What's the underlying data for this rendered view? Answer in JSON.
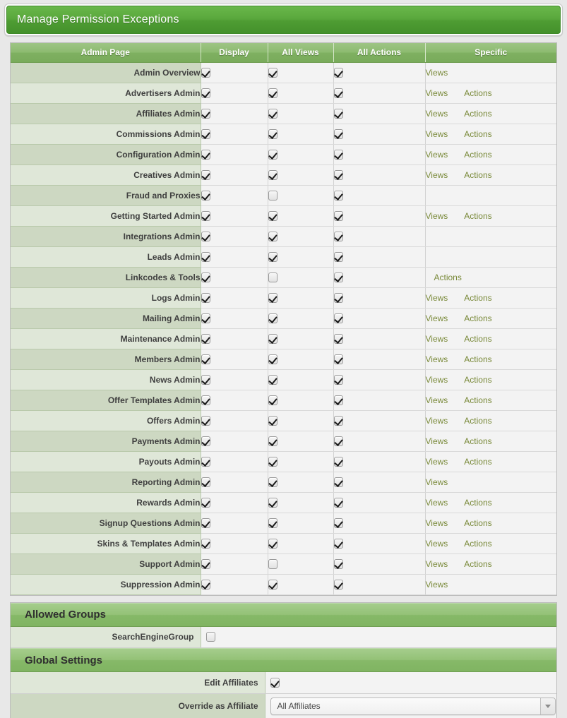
{
  "header": {
    "title": "Manage Permission Exceptions"
  },
  "permissions_table": {
    "columns": [
      "Admin Page",
      "Display",
      "All Views",
      "All Actions",
      "Specific"
    ],
    "specific_labels": {
      "views": "Views",
      "actions": "Actions"
    },
    "rows": [
      {
        "page": "Admin Overview",
        "display": true,
        "all_views": true,
        "all_actions": true,
        "views": true,
        "actions": false
      },
      {
        "page": "Advertisers Admin",
        "display": true,
        "all_views": true,
        "all_actions": true,
        "views": true,
        "actions": true
      },
      {
        "page": "Affiliates Admin",
        "display": true,
        "all_views": true,
        "all_actions": true,
        "views": true,
        "actions": true
      },
      {
        "page": "Commissions Admin",
        "display": true,
        "all_views": true,
        "all_actions": true,
        "views": true,
        "actions": true
      },
      {
        "page": "Configuration Admin",
        "display": true,
        "all_views": true,
        "all_actions": true,
        "views": true,
        "actions": true
      },
      {
        "page": "Creatives Admin",
        "display": true,
        "all_views": true,
        "all_actions": true,
        "views": true,
        "actions": true
      },
      {
        "page": "Fraud and Proxies",
        "display": true,
        "all_views": false,
        "all_actions": true,
        "views": false,
        "actions": false
      },
      {
        "page": "Getting Started Admin",
        "display": true,
        "all_views": true,
        "all_actions": true,
        "views": true,
        "actions": true
      },
      {
        "page": "Integrations Admin",
        "display": true,
        "all_views": true,
        "all_actions": true,
        "views": false,
        "actions": false
      },
      {
        "page": "Leads Admin",
        "display": true,
        "all_views": true,
        "all_actions": true,
        "views": false,
        "actions": false
      },
      {
        "page": "Linkcodes & Tools",
        "display": true,
        "all_views": false,
        "all_actions": true,
        "views": false,
        "actions": true
      },
      {
        "page": "Logs Admin",
        "display": true,
        "all_views": true,
        "all_actions": true,
        "views": true,
        "actions": true
      },
      {
        "page": "Mailing Admin",
        "display": true,
        "all_views": true,
        "all_actions": true,
        "views": true,
        "actions": true
      },
      {
        "page": "Maintenance Admin",
        "display": true,
        "all_views": true,
        "all_actions": true,
        "views": true,
        "actions": true
      },
      {
        "page": "Members Admin",
        "display": true,
        "all_views": true,
        "all_actions": true,
        "views": true,
        "actions": true
      },
      {
        "page": "News Admin",
        "display": true,
        "all_views": true,
        "all_actions": true,
        "views": true,
        "actions": true
      },
      {
        "page": "Offer Templates Admin",
        "display": true,
        "all_views": true,
        "all_actions": true,
        "views": true,
        "actions": true
      },
      {
        "page": "Offers Admin",
        "display": true,
        "all_views": true,
        "all_actions": true,
        "views": true,
        "actions": true
      },
      {
        "page": "Payments Admin",
        "display": true,
        "all_views": true,
        "all_actions": true,
        "views": true,
        "actions": true
      },
      {
        "page": "Payouts Admin",
        "display": true,
        "all_views": true,
        "all_actions": true,
        "views": true,
        "actions": true
      },
      {
        "page": "Reporting Admin",
        "display": true,
        "all_views": true,
        "all_actions": true,
        "views": true,
        "actions": false
      },
      {
        "page": "Rewards Admin",
        "display": true,
        "all_views": true,
        "all_actions": true,
        "views": true,
        "actions": true
      },
      {
        "page": "Signup Questions Admin",
        "display": true,
        "all_views": true,
        "all_actions": true,
        "views": true,
        "actions": true
      },
      {
        "page": "Skins & Templates Admin",
        "display": true,
        "all_views": true,
        "all_actions": true,
        "views": true,
        "actions": true
      },
      {
        "page": "Support Admin",
        "display": true,
        "all_views": false,
        "all_actions": true,
        "views": true,
        "actions": true
      },
      {
        "page": "Suppression Admin",
        "display": true,
        "all_views": true,
        "all_actions": true,
        "views": true,
        "actions": false
      }
    ]
  },
  "allowed_groups": {
    "title": "Allowed Groups",
    "rows": [
      {
        "label": "SearchEngineGroup",
        "checked": false
      }
    ]
  },
  "global_settings": {
    "title": "Global Settings",
    "edit_affiliates": {
      "label": "Edit Affiliates",
      "checked": true
    },
    "override_as_affiliate": {
      "label": "Override as Affiliate",
      "value": "All Affiliates"
    }
  },
  "colors": {
    "title_green_top": "#69b74a",
    "title_green_bottom": "#44912b",
    "header_green": "#8cba6f",
    "section_green": "#93c176",
    "link_olive": "#7a8a3a",
    "row_odd": "#cdd8c2",
    "row_even": "#dfe7d8",
    "cell_bg": "#f3f3f3"
  }
}
